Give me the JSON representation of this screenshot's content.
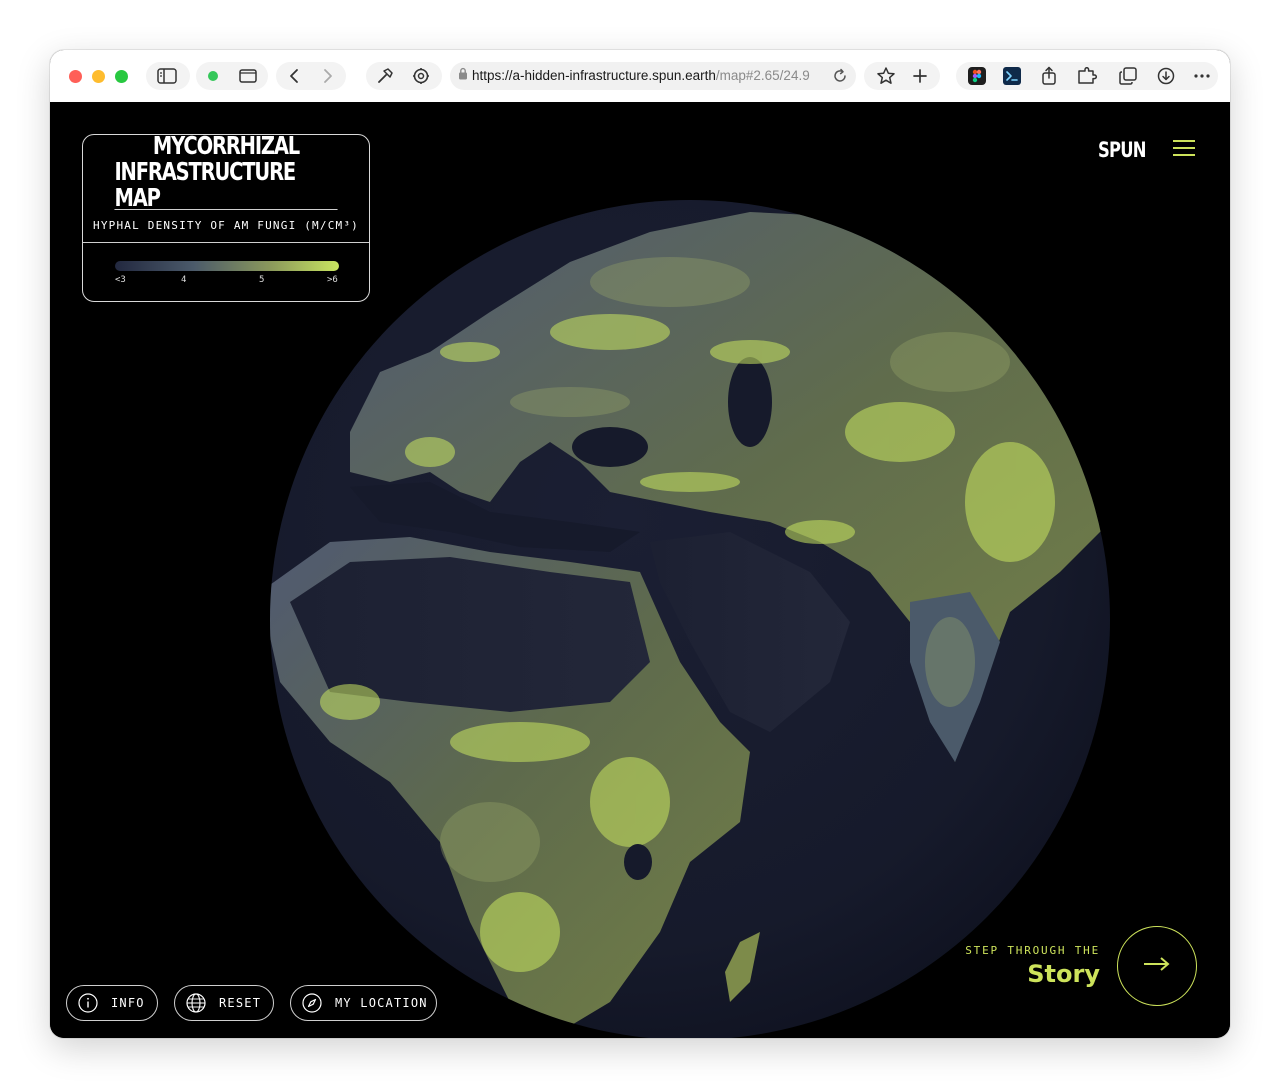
{
  "browser": {
    "url_host": "https://a-hidden-infrastructure.spun.earth",
    "url_path": "/map#2.65/24.9",
    "icons": [
      "sidebar-icon",
      "tab-overview-icon",
      "back-icon",
      "forward-icon",
      "hammer-icon",
      "settings-icon",
      "lock-icon",
      "reload-icon",
      "star-icon",
      "new-tab-icon",
      "figma-icon",
      "terminal-icon",
      "share-icon",
      "extension-icon",
      "tabs-icon",
      "download-icon",
      "more-icon"
    ],
    "colors": {
      "close": "#ff5f57",
      "minimize": "#febc2e",
      "zoom": "#28c840",
      "active_dot": "#34c759"
    }
  },
  "legend": {
    "title_line1": "MYCORRHIZAL",
    "title_line2": "INFRASTRUCTURE MAP",
    "subtitle": "HYPHAL DENSITY OF AM FUNGI (M/CM³)",
    "ticks": [
      "<3",
      "4",
      "5",
      ">6"
    ],
    "gradient_colors": [
      "#22283f",
      "#4b5a6a",
      "#8c9a5c",
      "#c9e560"
    ]
  },
  "header": {
    "brand": "SPUN",
    "menu_icon": "hamburger-icon"
  },
  "controls": {
    "info_label": "INFO",
    "info_icon": "info-icon",
    "reset_label": "RESET",
    "reset_icon": "globe-icon",
    "location_label": "MY LOCATION",
    "location_icon": "compass-icon"
  },
  "story": {
    "kicker": "STEP THROUGH THE",
    "title": "Story",
    "arrow_icon": "arrow-right-icon"
  },
  "theme": {
    "accent": "#cde35b",
    "background": "#000000",
    "ocean": "#171a2c"
  }
}
